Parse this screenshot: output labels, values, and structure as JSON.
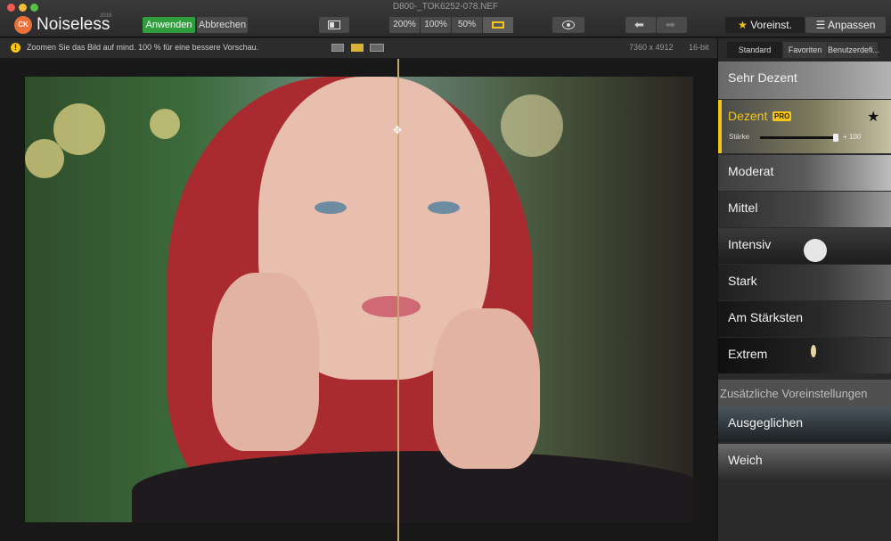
{
  "window": {
    "title": "D800-_TOK6252-078.NEF"
  },
  "app": {
    "logo_text": "CK",
    "name": "Noiseless",
    "edition": "2016"
  },
  "toolbar": {
    "apply_label": "Anwenden",
    "cancel_label": "Abbrechen",
    "zoom_200": "200%",
    "zoom_100": "100%",
    "zoom_50": "50%",
    "undo_glyph": "⬅",
    "redo_glyph": "➡",
    "presets_tab": "Voreinst.",
    "adjust_tab": "Anpassen",
    "star_glyph": "★",
    "sliders_glyph": "☰"
  },
  "hint": {
    "icon": "!",
    "text": "Zoomen Sie das Bild auf mind. 100 % für eine bessere Vorschau.",
    "image_size": "7360 x 4912",
    "bit_depth": "16-bit"
  },
  "canvas": {
    "split_handle_glyph": "✥"
  },
  "panel": {
    "tabs": [
      "Standard",
      "Favoriten",
      "Benutzerdefi..."
    ],
    "presets": [
      {
        "label": "Sehr Dezent"
      },
      {
        "label": "Dezent",
        "badge": "PRO",
        "favorite_glyph": "★",
        "strength_label": "Stärke",
        "strength_value_text": "+ 100",
        "strength_value": 100
      },
      {
        "label": "Moderat"
      },
      {
        "label": "Mittel"
      },
      {
        "label": "Intensiv"
      },
      {
        "label": "Stark"
      },
      {
        "label": "Am Stärksten"
      },
      {
        "label": "Extrem"
      }
    ],
    "section_title": "Zusätzliche Voreinstellungen",
    "extra_presets": [
      {
        "label": "Ausgeglichen"
      },
      {
        "label": "Weich"
      }
    ]
  },
  "colors": {
    "accent": "#f5c518",
    "apply": "#2f9e3d"
  },
  "icons": {
    "logo": "logo-icon",
    "split_view": "split-view-icon",
    "fit": "fit-screen-icon",
    "eye": "preview-eye-icon",
    "undo": "undo-arrow-icon",
    "redo": "redo-arrow-icon",
    "warning": "warning-icon"
  }
}
